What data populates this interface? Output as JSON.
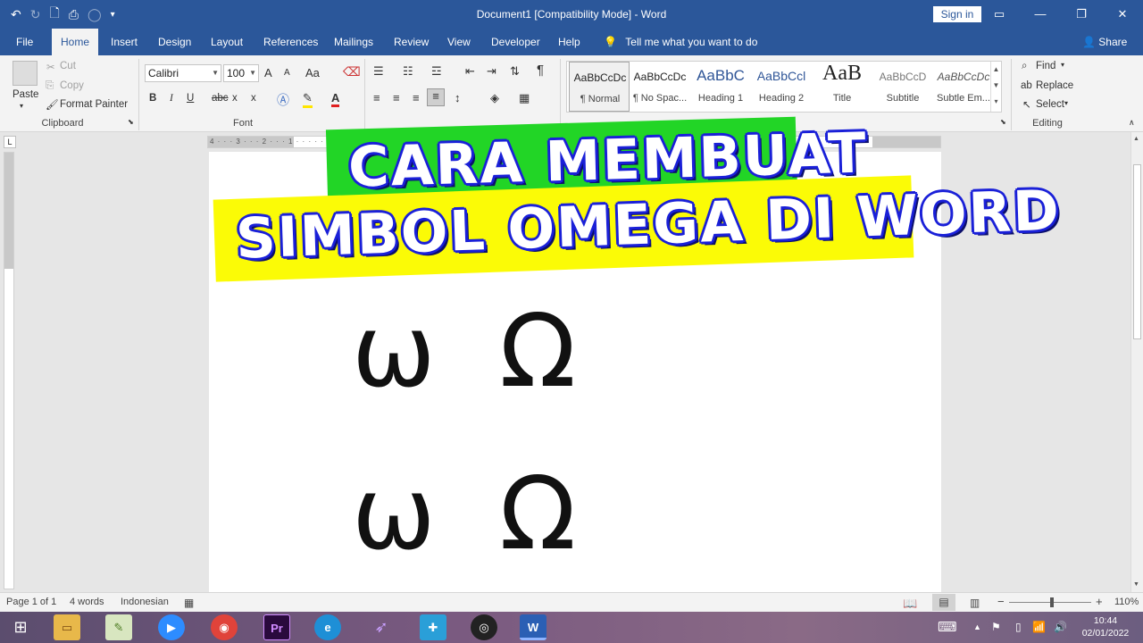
{
  "window": {
    "title": "Document1 [Compatibility Mode]  -  Word",
    "sign_in": "Sign in"
  },
  "menu": {
    "tabs": [
      "File",
      "Home",
      "Insert",
      "Design",
      "Layout",
      "References",
      "Mailings",
      "Review",
      "View",
      "Developer",
      "Help"
    ],
    "active": "Home",
    "tell_me": "Tell me what you want to do",
    "share": "Share"
  },
  "clipboard": {
    "paste": "Paste",
    "cut": "Cut",
    "copy": "Copy",
    "format_painter": "Format Painter",
    "label": "Clipboard"
  },
  "font": {
    "name": "Calibri",
    "size": "100",
    "label": "Font",
    "grow": "A",
    "shrink": "A",
    "case": "Aa",
    "bold": "B",
    "italic": "I",
    "underline": "U",
    "strike": "abc",
    "subscript": "x",
    "superscript": "x"
  },
  "styles": {
    "items": [
      {
        "preview": "AaBbCcDc",
        "name": "¶ Normal"
      },
      {
        "preview": "AaBbCcDc",
        "name": "¶ No Spac..."
      },
      {
        "preview": "AaBbC",
        "name": "Heading 1"
      },
      {
        "preview": "AaBbCcl",
        "name": "Heading 2"
      },
      {
        "preview": "AaB",
        "name": "Title"
      },
      {
        "preview": "AaBbCcD",
        "name": "Subtitle"
      },
      {
        "preview": "AaBbCcDc",
        "name": "Subtle Em..."
      }
    ]
  },
  "editing": {
    "find": "Find",
    "replace": "Replace",
    "select": "Select",
    "label": "Editing"
  },
  "document": {
    "line1": "ω Ω",
    "line2": "ω Ω"
  },
  "banner": {
    "line1": "CARA MEMBUAT",
    "line2": "SIMBOL OMEGA DI WORD"
  },
  "ruler": {
    "ticks": "4 · · · 3 · · · 2 · · · 1 · · · · · · · 1 · · · 2 · · · 3 · · · 4 · · · 5 · · · 6 · · · 7 · · · 8 · · · 9 · · · 10 · · · 11 · · · 12 · · · 13 · · · 14 · · · 15 · · · 16 · ·"
  },
  "status": {
    "page": "Page 1 of 1",
    "words": "4 words",
    "language": "Indonesian",
    "zoom": "110%"
  },
  "taskbar": {
    "time": "10:44",
    "date": "02/01/2022"
  },
  "colors": {
    "word_blue": "#2b579a",
    "banner_green": "#22d526",
    "banner_yellow": "#fbfb06",
    "banner_outline": "#1a20d8"
  }
}
